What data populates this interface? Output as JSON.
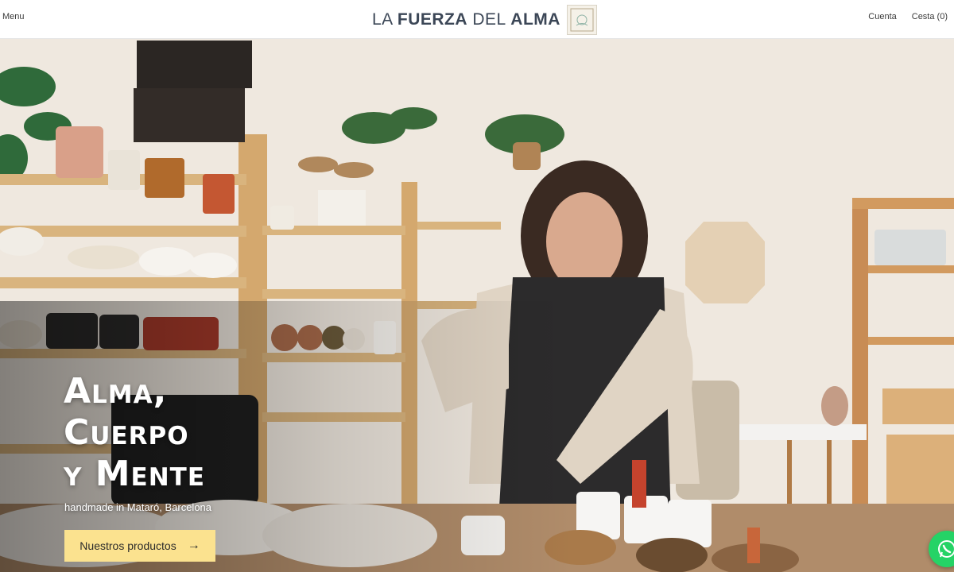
{
  "header": {
    "menu_label": "Menu",
    "logo_regular_1": "LA ",
    "logo_bold_1": "FUERZA",
    "logo_regular_2": " DEL ",
    "logo_bold_2": "ALMA",
    "account_label": "Cuenta",
    "cart_label": "Cesta (0)"
  },
  "hero": {
    "title_lines": [
      "Alma,",
      "Cuerpo",
      "y Mente"
    ],
    "subtitle": "handmade in Mataró, Barcelona",
    "cta_label": "Nuestros productos",
    "cta_icon": "arrow-right-icon"
  },
  "colors": {
    "cta_background": "#fbe28f",
    "whatsapp_green": "#25d366",
    "logo_text": "#3b4656"
  }
}
